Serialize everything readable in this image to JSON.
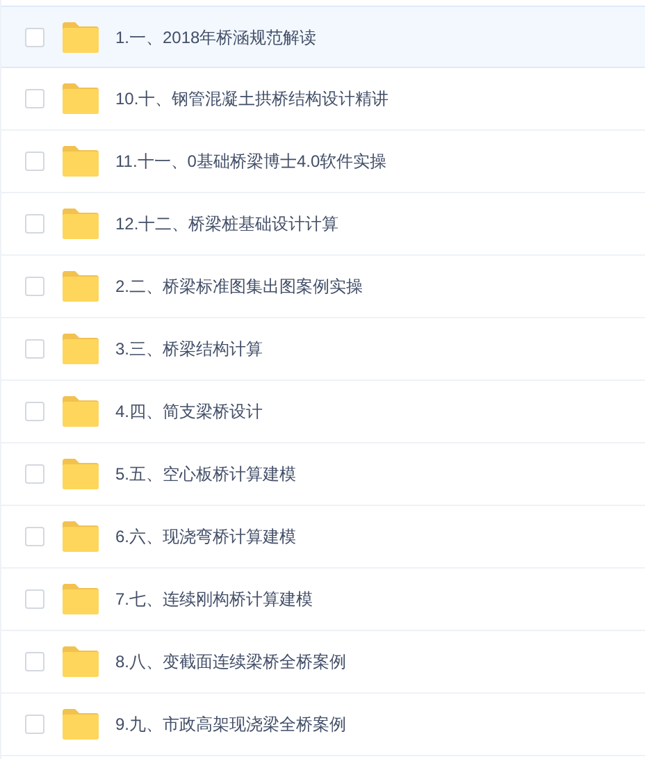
{
  "files": [
    {
      "name": "1.一、2018年桥涵规范解读",
      "selected": true,
      "checked": false
    },
    {
      "name": "10.十、钢管混凝土拱桥结构设计精讲",
      "selected": false,
      "checked": false
    },
    {
      "name": "11.十一、0基础桥梁博士4.0软件实操",
      "selected": false,
      "checked": false
    },
    {
      "name": "12.十二、桥梁桩基础设计计算",
      "selected": false,
      "checked": false
    },
    {
      "name": "2.二、桥梁标准图集出图案例实操",
      "selected": false,
      "checked": false
    },
    {
      "name": "3.三、桥梁结构计算",
      "selected": false,
      "checked": false
    },
    {
      "name": "4.四、简支梁桥设计",
      "selected": false,
      "checked": false
    },
    {
      "name": "5.五、空心板桥计算建模",
      "selected": false,
      "checked": false
    },
    {
      "name": "6.六、现浇弯桥计算建模",
      "selected": false,
      "checked": false
    },
    {
      "name": "7.七、连续刚构桥计算建模",
      "selected": false,
      "checked": false
    },
    {
      "name": "8.八、变截面连续梁桥全桥案例",
      "selected": false,
      "checked": false
    },
    {
      "name": "9.九、市政高架现浇梁全桥案例",
      "selected": false,
      "checked": false
    }
  ]
}
